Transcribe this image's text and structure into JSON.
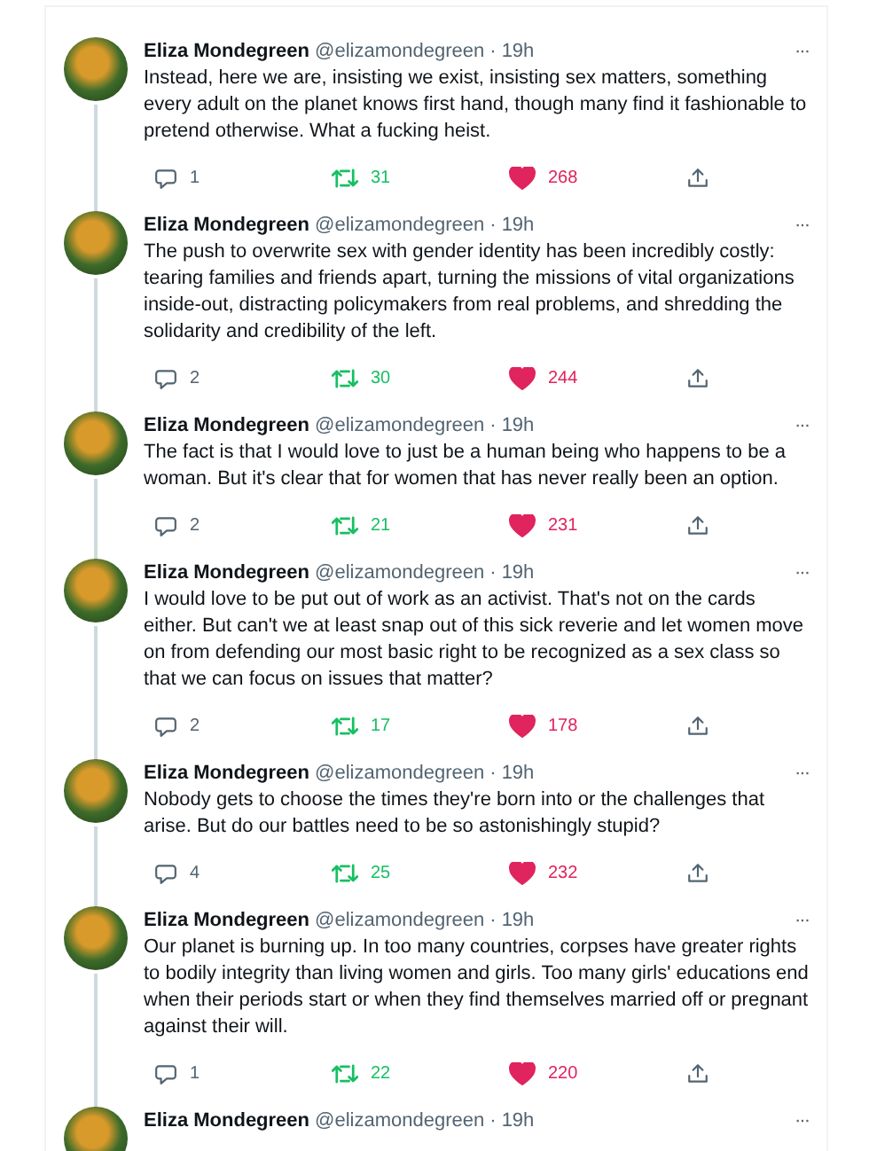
{
  "tweets": [
    {
      "name": "Eliza Mondegreen",
      "handle": "@elizamondegreen",
      "time": "· 19h",
      "more": "···",
      "text": "Instead, here we are, insisting we exist, insisting sex matters, something every adult on the planet knows first hand, though many find it fashionable to pretend otherwise. What a fucking heist.",
      "replies": "1",
      "retweets": "31",
      "likes": "268",
      "retweeted": true,
      "liked": true
    },
    {
      "name": "Eliza Mondegreen",
      "handle": "@elizamondegreen",
      "time": "· 19h",
      "more": "···",
      "text": "The push to overwrite sex with gender identity has been incredibly costly: tearing families and friends apart, turning the missions of vital organizations inside-out, distracting policymakers from real problems, and shredding the solidarity and credibility of the left.",
      "replies": "2",
      "retweets": "30",
      "likes": "244",
      "retweeted": true,
      "liked": true
    },
    {
      "name": "Eliza Mondegreen",
      "handle": "@elizamondegreen",
      "time": "· 19h",
      "more": "···",
      "text": "The fact is that I would love to just be a human being who happens to be a woman. But it's clear that for women that has never really been an option.",
      "replies": "2",
      "retweets": "21",
      "likes": "231",
      "retweeted": true,
      "liked": true
    },
    {
      "name": "Eliza Mondegreen",
      "handle": "@elizamondegreen",
      "time": "· 19h",
      "more": "···",
      "text": "I would love to be put out of work as an activist. That's not on the cards either. But can't we at least snap out of this sick reverie and let women move on from defending our most basic right to be recognized as a sex class so that we can focus on issues that matter?",
      "replies": "2",
      "retweets": "17",
      "likes": "178",
      "retweeted": true,
      "liked": true
    },
    {
      "name": "Eliza Mondegreen",
      "handle": "@elizamondegreen",
      "time": "· 19h",
      "more": "···",
      "text": "Nobody gets to choose the times they're born into or the challenges that arise. But do our battles need to be so astonishingly stupid?",
      "replies": "4",
      "retweets": "25",
      "likes": "232",
      "retweeted": true,
      "liked": true
    },
    {
      "name": "Eliza Mondegreen",
      "handle": "@elizamondegreen",
      "time": "· 19h",
      "more": "···",
      "text": "Our planet is burning up. In too many countries, corpses have greater rights to bodily integrity than living women and girls. Too many girls' educations end when their periods start or when they find themselves married off or pregnant against their will.",
      "replies": "1",
      "retweets": "22",
      "likes": "220",
      "retweeted": true,
      "liked": true
    },
    {
      "name": "Eliza Mondegreen",
      "handle": "@elizamondegreen",
      "time": "· 19h",
      "more": "···"
    }
  ]
}
